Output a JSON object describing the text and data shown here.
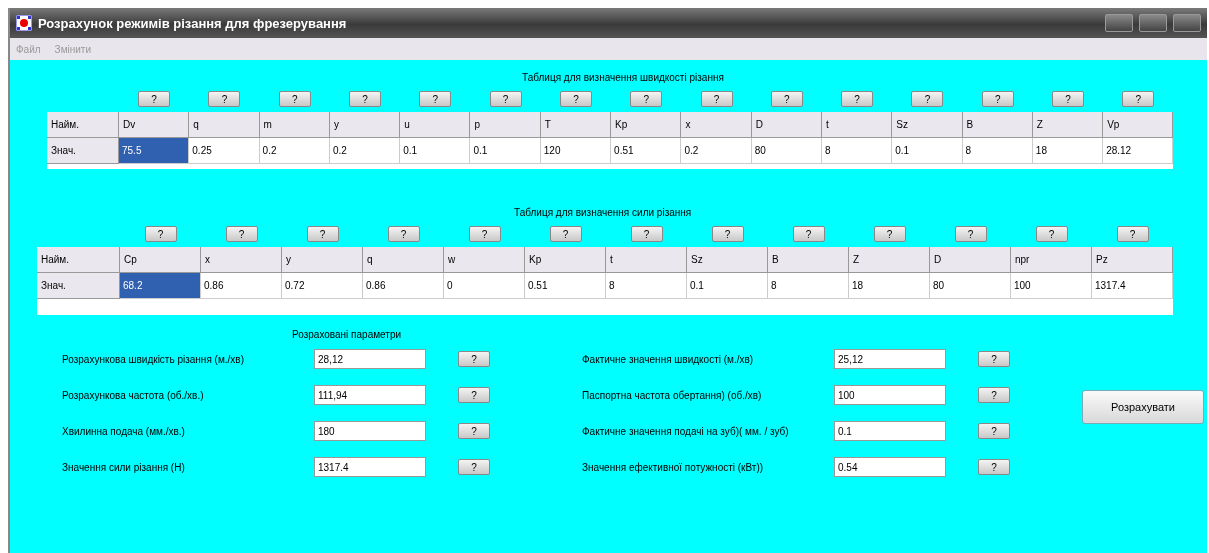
{
  "window": {
    "title": "Розрахунок режимів різання для фрезерування"
  },
  "menu": [
    "Файл",
    "Змінити"
  ],
  "speed_table": {
    "title": "Таблиця для визначення швидкості різання",
    "help_buttons": [
      "?",
      "?",
      "?",
      "?",
      "?",
      "?",
      "?",
      "?",
      "?",
      "?",
      "?",
      "?",
      "?",
      "?",
      "?"
    ],
    "row_headers": [
      "Найм.",
      "Знач."
    ],
    "columns": [
      "Dv",
      "q",
      "m",
      "y",
      "u",
      "p",
      "T",
      "Kp",
      "x",
      "D",
      "t",
      "Sz",
      "B",
      "Z",
      "Vp"
    ],
    "values": [
      {
        "text": "75.5",
        "selected": true
      },
      {
        "text": "0.25",
        "selected": false
      },
      {
        "text": "0.2",
        "selected": false
      },
      {
        "text": "0.2",
        "selected": false
      },
      {
        "text": "0.1",
        "selected": false
      },
      {
        "text": "0.1",
        "selected": false
      },
      {
        "text": "120",
        "selected": false
      },
      {
        "text": "0.51",
        "selected": false
      },
      {
        "text": "0.2",
        "selected": false
      },
      {
        "text": "80",
        "selected": false
      },
      {
        "text": "8",
        "selected": false
      },
      {
        "text": "0.1",
        "selected": false
      },
      {
        "text": "8",
        "selected": false
      },
      {
        "text": "18",
        "selected": false
      },
      {
        "text": "28.12",
        "selected": false
      }
    ]
  },
  "force_table": {
    "title": "Таблиця для визначення сили різання",
    "help_buttons": [
      "?",
      "?",
      "?",
      "?",
      "?",
      "?",
      "?",
      "?",
      "?",
      "?",
      "?",
      "?",
      "?"
    ],
    "row_headers": [
      "Найм.",
      "Знач."
    ],
    "columns": [
      "Cp",
      "x",
      "y",
      "q",
      "w",
      "Kp",
      "t",
      "Sz",
      "B",
      "Z",
      "D",
      "npr",
      "Pz"
    ],
    "values": [
      {
        "text": "68.2",
        "selected": true
      },
      {
        "text": "0.86",
        "selected": false
      },
      {
        "text": "0.72",
        "selected": false
      },
      {
        "text": "0.86",
        "selected": false
      },
      {
        "text": "0",
        "selected": false
      },
      {
        "text": "0.51",
        "selected": false
      },
      {
        "text": "8",
        "selected": false
      },
      {
        "text": "0.1",
        "selected": false
      },
      {
        "text": "8",
        "selected": false
      },
      {
        "text": "18",
        "selected": false
      },
      {
        "text": "80",
        "selected": false
      },
      {
        "text": "100",
        "selected": false
      },
      {
        "text": "1317.4",
        "selected": false
      }
    ]
  },
  "results": {
    "title": "Розраховані параметри",
    "left": [
      {
        "label": "Розрахункова швидкість різання (м./хв)",
        "value": "28,12",
        "button": "?"
      },
      {
        "label": "Розрахункова частота (об./хв.)",
        "value": "111,94",
        "button": "?"
      },
      {
        "label": "Хвилинна подача (мм./хв.)",
        "value": "180",
        "button": "?"
      },
      {
        "label": "Значення сили різання (Н)",
        "value": "1317.4",
        "button": "?"
      }
    ],
    "right": [
      {
        "label": "Фактичне значення швидкості (м./хв)",
        "value": "25,12",
        "button": "?"
      },
      {
        "label": "Паспортна частота обертання) (об./хв)",
        "value": "100",
        "button": "?"
      },
      {
        "label": "Фактичне значення подачі на зуб)( мм. / зуб)",
        "value": "0.1",
        "button": "?"
      },
      {
        "label": "Значення ефективної потужності (кВт))",
        "value": "0.54",
        "button": "?"
      }
    ],
    "calculate_button": "Розрахувати"
  }
}
